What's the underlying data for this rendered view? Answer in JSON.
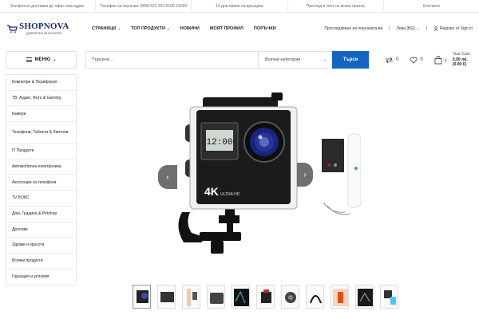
{
  "topbar": [
    "Експресна доставка до офис или адрес",
    "Телефон за поръчки: 0899 821 333 /9:00-18:00/",
    "14 дни право на връщане",
    "Преглед и тест на всяка пратка",
    "Контакти"
  ],
  "logo": {
    "brand": "SHOPNOVA",
    "tagline": "ДИРЕКТЕН ВНОСИТЕЛ"
  },
  "nav": [
    {
      "label": "СТРАНИЦИ",
      "chevron": true
    },
    {
      "label": "ТОП ПРОДУКТИ",
      "chevron": true
    },
    {
      "label": "НОВИНИ",
      "chevron": false
    },
    {
      "label": "МОЯТ ПРОФИЛ",
      "chevron": false
    },
    {
      "label": "ПОРЪЧКИ",
      "chevron": false
    }
  ],
  "header_right": {
    "track": "Проследяване на поръчката ви",
    "currency": "Лева (BG)",
    "account": "Register or Sign in"
  },
  "menu_button": {
    "label": "МЕНЮ"
  },
  "search": {
    "placeholder": "Търсене...",
    "category": "Всички категории",
    "button": "Търси"
  },
  "counters": {
    "compare": "0",
    "wishlist": "0",
    "cart": "0"
  },
  "cart": {
    "label": "Your Cart:",
    "total": "0.00 лв.",
    "total_eur": "(0.00 €)"
  },
  "categories": [
    "Компютри & Периферия",
    "ТВ, Аудио, Фото & Gaming",
    "Камери",
    "Телефони, Таблети & Лаптопи",
    "IT Продукти",
    "Автомобилна електроника",
    "Аксесоари за телефони",
    "TV БОКС",
    "Дом, Градина & Petshop",
    "Дронове",
    "Здраве и красота",
    "Всички продукти",
    "Гаранция и условия"
  ],
  "product": {
    "screen_time": "12:00",
    "badge_4k": "4K",
    "badge_ultra": "ULTRA HD"
  },
  "thumbnail_count": 11,
  "colors": {
    "accent": "#1565c0",
    "brand": "#1b2a6b"
  }
}
